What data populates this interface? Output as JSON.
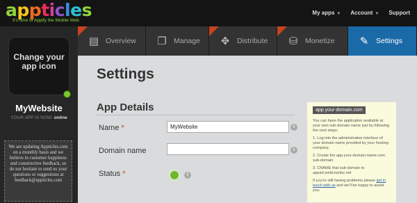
{
  "brand": {
    "logo_letters": [
      "a",
      "p",
      "p",
      "t",
      "i",
      "c",
      "l",
      "e",
      "s"
    ],
    "logo_colors": [
      "#8fd33b",
      "#f7c51c",
      "#ef6a1f",
      "#ec2e5b",
      "#d23fa0",
      "#8e54c8",
      "#3b8fe0",
      "#2fc1d6",
      "#8fd33b"
    ],
    "tagline": "It's time to Appify the Mobile Web"
  },
  "topnav": {
    "my_apps": "My apps",
    "account": "Account",
    "support": "Support"
  },
  "left": {
    "change_icon_text": "Change your app icon",
    "site_name": "MyWebsite",
    "status_prefix": "YOUR APP IS NOW:",
    "status_value": "online",
    "notice": "We are updating Appticles.com on a monthly basis and we believe in customer happiness and constructive feedback, so do not hesitate to send us your questions or suggestions at feedback@appticles.com"
  },
  "tabs": [
    {
      "label": "Overview",
      "icon": "document-icon",
      "ribbon": true
    },
    {
      "label": "Manage",
      "icon": "pages-icon",
      "ribbon": false
    },
    {
      "label": "Distribute",
      "icon": "share-icon",
      "ribbon": true
    },
    {
      "label": "Monetize",
      "icon": "coins-icon",
      "ribbon": true
    },
    {
      "label": "Settings",
      "icon": "tools-icon",
      "ribbon": false,
      "active": true
    }
  ],
  "main": {
    "title": "Settings",
    "section_title": "App Details",
    "fields": {
      "name_label": "Name",
      "name_value": "MyWebsite",
      "domain_label": "Domain name",
      "domain_value": "",
      "status_label": "Status",
      "required_mark": "*"
    }
  },
  "side_panel": {
    "badge": "app.your-domain.com",
    "intro": "You can have the application available at your own sub-domain name just by following the next steps:",
    "step1": "1. Log into the administrative interface of your domain name provided by your hosting company.",
    "step2": "2. Create the app.your-domain-name.com sub-domain.",
    "step3": "3. CNAME that sub-domain to appart.webcrumbz.net",
    "help_prefix": "If you're still having problems please",
    "help_link": "get in touch with us",
    "help_suffix": "and we'll be happy to assist you."
  },
  "colors": {
    "active_tab": "#1a6aa8",
    "ribbon": "#c8431e",
    "status_online": "#6fb72c"
  }
}
